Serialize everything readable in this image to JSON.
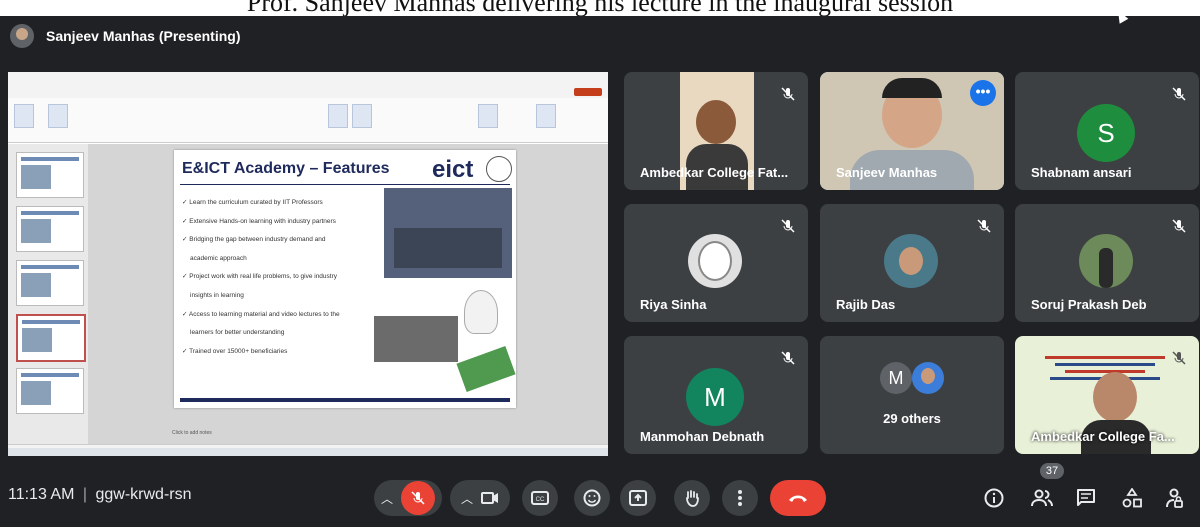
{
  "caption": "Prof. Sanjeev Manhas delivering his lecture in the inaugural session",
  "presenter": {
    "label": "Sanjeev Manhas (Presenting)"
  },
  "slide": {
    "title": "E&ICT Academy – Features",
    "logo": "eict",
    "features": [
      "✓ Learn the curriculum curated by IIT Professors",
      "✓ Extensive Hands-on learning with industry partners",
      "✓ Bridging the gap between industry demand and",
      "academic approach",
      "✓ Project work with real life problems, to give industry",
      "insights in learning",
      "✓ Access to learning material and video lectures to the",
      "learners for better understanding",
      "✓ Trained over 15000+ beneficiaries"
    ],
    "notes": "Click to add notes"
  },
  "participants": [
    {
      "name": "Ambedkar College Fat...",
      "muted": true
    },
    {
      "name": "Sanjeev Manhas",
      "speaking": true
    },
    {
      "name": "Shabnam ansari",
      "initial": "S",
      "color": "#1e8e3e",
      "muted": true
    },
    {
      "name": "Riya Sinha",
      "muted": true
    },
    {
      "name": "Rajib Das",
      "muted": true
    },
    {
      "name": "Soruj Prakash Deb",
      "muted": true
    },
    {
      "name": "Manmohan Debnath",
      "initial": "M",
      "color": "#12845e",
      "muted": true
    },
    {
      "name": "29 others",
      "initial": "M",
      "color": "#5f6368"
    },
    {
      "name": "Ambedkar College Fa...",
      "muted": true
    }
  ],
  "meeting": {
    "time": "11:13 AM",
    "separator": "|",
    "code": "ggw-krwd-rsn",
    "participant_count": "37"
  },
  "icons": [
    "mic-off-icon",
    "camera-icon",
    "captions-icon",
    "emoji-icon",
    "present-icon",
    "raise-hand-icon",
    "more-icon",
    "end-call-icon",
    "info-icon",
    "people-icon",
    "chat-icon",
    "activities-icon",
    "host-controls-icon"
  ]
}
